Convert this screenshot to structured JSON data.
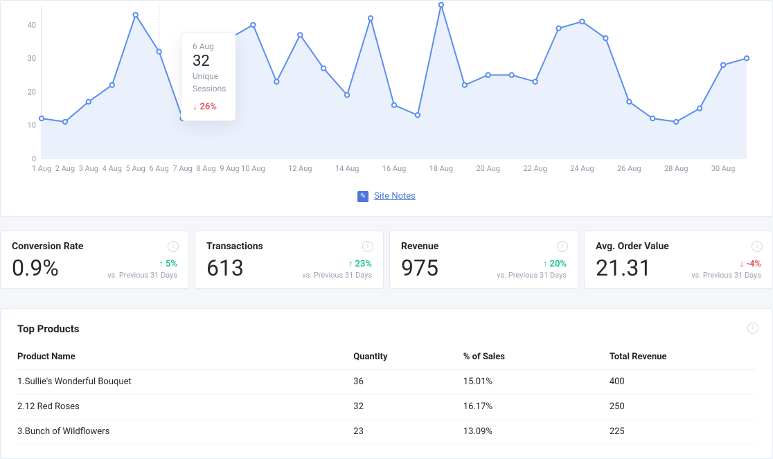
{
  "chart_data": {
    "type": "line",
    "title": "",
    "xlabel": "",
    "ylabel": "",
    "ylim": [
      0,
      46
    ],
    "yticks": [
      0,
      10,
      20,
      30,
      40
    ],
    "x_labels": [
      "1 Aug",
      "2 Aug",
      "3 Aug",
      "4 Aug",
      "5 Aug",
      "6 Aug",
      "7 Aug",
      "8 Aug",
      "9 Aug",
      "10 Aug",
      "",
      "12 Aug",
      "",
      "14 Aug",
      "",
      "16 Aug",
      "",
      "18 Aug",
      "",
      "20 Aug",
      "",
      "22 Aug",
      "",
      "24 Aug",
      "",
      "26 Aug",
      "",
      "28 Aug",
      "",
      "30 Aug",
      ""
    ],
    "x_days": [
      1,
      2,
      3,
      4,
      5,
      6,
      7,
      8,
      9,
      10,
      11,
      12,
      13,
      14,
      15,
      16,
      17,
      18,
      19,
      20,
      21,
      22,
      23,
      24,
      25,
      26,
      27,
      28,
      29,
      30,
      31
    ],
    "series": [
      {
        "name": "Unique Sessions",
        "values": [
          12,
          11,
          17,
          22,
          43,
          32,
          12,
          30,
          36,
          40,
          23,
          37,
          27,
          19,
          42,
          16,
          13,
          46,
          22,
          25,
          25,
          23,
          39,
          41,
          36,
          17,
          12,
          11,
          15,
          28,
          30
        ]
      }
    ],
    "tooltip": {
      "date": "6 Aug",
      "value": "32",
      "metric_line1": "Unique",
      "metric_line2": "Sessions",
      "delta": "26%",
      "direction": "down",
      "x_index": 5
    }
  },
  "site_notes_label": "Site Notes",
  "stats": [
    {
      "title": "Conversion Rate",
      "value": "0.9%",
      "delta": "5%",
      "direction": "up",
      "vs": "vs. Previous 31 Days"
    },
    {
      "title": "Transactions",
      "value": "613",
      "delta": "23%",
      "direction": "up",
      "vs": "vs. Previous 31 Days"
    },
    {
      "title": "Revenue",
      "value": "975",
      "delta": "20%",
      "direction": "up",
      "vs": "vs. Previous 31 Days"
    },
    {
      "title": "Avg. Order Value",
      "value": "21.31",
      "delta": "-4%",
      "direction": "down",
      "vs": "vs. Previous 31 Days"
    }
  ],
  "top_products": {
    "title": "Top Products",
    "columns": {
      "name": "Product Name",
      "qty": "Quantity",
      "pct": "% of Sales",
      "rev": "Total Revenue"
    },
    "rows": [
      {
        "idx": "1.",
        "name": "Sullie's Wonderful Bouquet",
        "qty": "36",
        "pct": "15.01%",
        "rev": "400"
      },
      {
        "idx": "2.",
        "name": "12 Red Roses",
        "qty": "32",
        "pct": "16.17%",
        "rev": "250"
      },
      {
        "idx": "3.",
        "name": "Bunch of Wildflowers",
        "qty": "23",
        "pct": "13.09%",
        "rev": "225"
      }
    ]
  }
}
